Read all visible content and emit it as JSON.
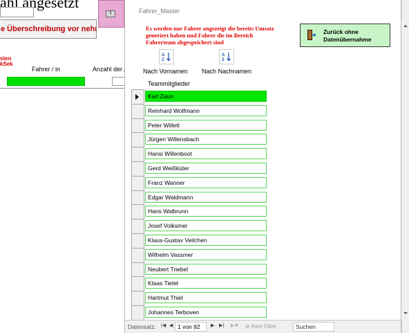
{
  "background": {
    "title_fragment": "ahl angesetzt",
    "button_label": "e Überschreibung vor nehmen!",
    "red_line1": "sten",
    "red_line2": "kSek",
    "col_driver": "Fahrer / in",
    "col_count": "Anzahl der Au"
  },
  "window": {
    "title": "Fahrer_Master",
    "notice": "Es werden nur Fahrer angezeigt die bereits Umsatz generiert haben und Fahrer die im Bereich Fahrerteam abgespeichert sind",
    "back_button_label": "Zurück ohne Datenübernahme",
    "sort_first_label": "Nach Vornamen",
    "sort_last_label": "Nach Nachnamen",
    "members_label": "Teammitglieder",
    "members": [
      "Karl Zaun",
      "Reinhard Wolfmann",
      "Peter Willett",
      "Jürgen Willensbach",
      "Hansi Willenboot",
      "Gerd Weißküter",
      "Franz Wanner",
      "Edgar Waldmann",
      "Hans Walbrunn",
      "Josef Volksmer",
      "Klaus-Gustav Veilchen",
      "Wilhelm Vassmer",
      "Neubert Triebel",
      "Klaas Tietel",
      "Hartmut Thiel",
      "Johannes Terboven"
    ],
    "colors": {
      "current_row": "#00e600",
      "row_border": "#54d554",
      "notice": "#e00000",
      "back_button": "#c8f5c8"
    }
  },
  "navigation": {
    "label": "Datensatz:",
    "record": "1 von 92",
    "filter": "Kein Filter",
    "search": "Suchen"
  }
}
